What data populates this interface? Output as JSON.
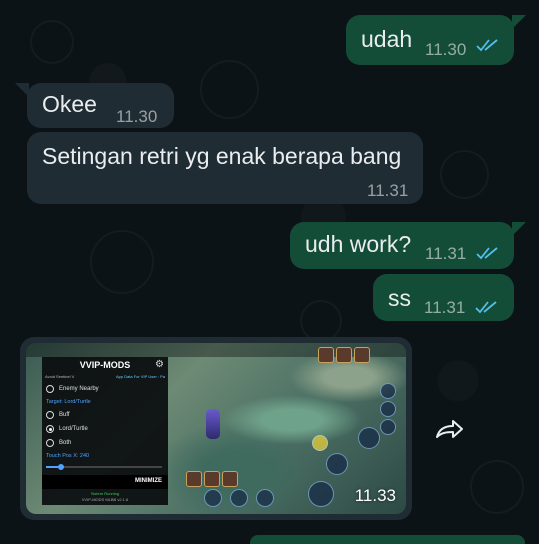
{
  "messages": [
    {
      "text": "udah",
      "time": "11.30",
      "direction": "out",
      "status": "read"
    },
    {
      "text": "Okee",
      "time": "11.30",
      "direction": "in"
    },
    {
      "text": "Setingan retri yg enak berapa bang",
      "time": "11.31",
      "direction": "in"
    },
    {
      "text": "udh work?",
      "time": "11.31",
      "direction": "out",
      "status": "read"
    },
    {
      "text": "ss",
      "time": "11.31",
      "direction": "out",
      "status": "read"
    }
  ],
  "media_message": {
    "time": "11.33",
    "direction": "in",
    "screenshot": {
      "menu_title": "VVIP-MODS",
      "sub_left": "Avoid Sentinel V",
      "sub_right": "App Data For VIP User : Pa",
      "option_enemy": "Enemy Nearby",
      "target_label": "Target: Lord/Turtle",
      "option_buff": "Buff",
      "option_lord": "Lord/Turtle",
      "option_both": "Both",
      "touch_label": "Touch Pos X: 240",
      "touch_value": 240,
      "minimize_label": "MINIMIZE",
      "footer_status": "Sistem Running",
      "footer_version": "VVIP-MODS MLBB v2.1.6"
    }
  },
  "icons": {
    "read_receipt": "double-check-icon",
    "forward": "forward-icon",
    "settings": "gear-icon"
  },
  "colors": {
    "outgoing_bubble": "#144d37",
    "incoming_bubble": "#202c33",
    "read_ticks": "#53bdeb",
    "background": "#0b141a"
  }
}
